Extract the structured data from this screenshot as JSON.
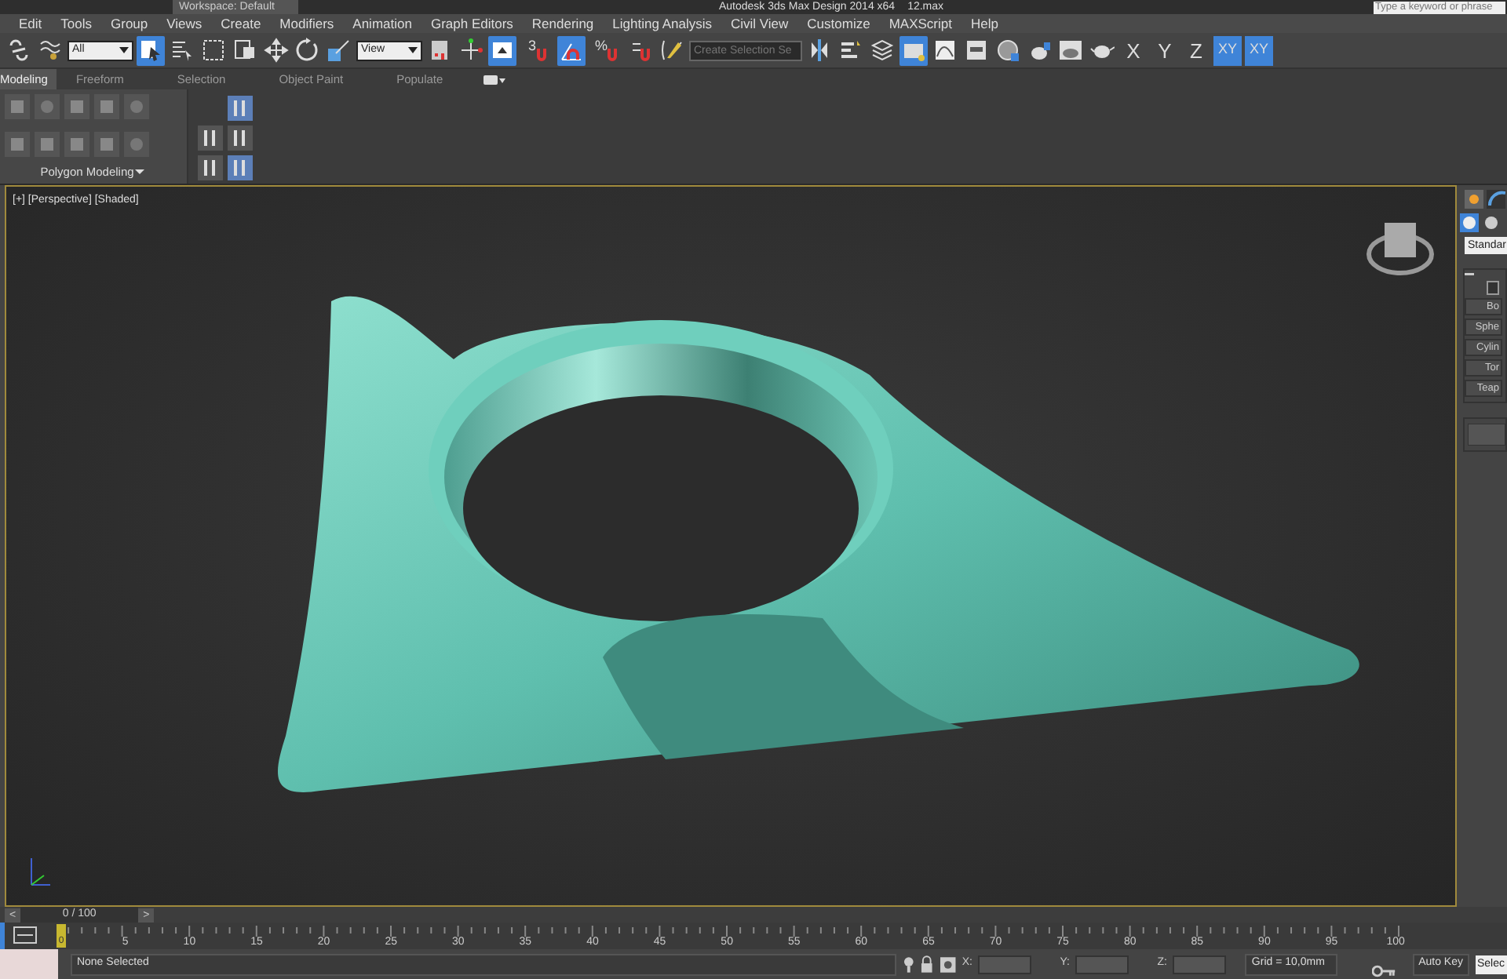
{
  "title_bar": {
    "workspace": "Workspace: Default",
    "title": "Autodesk 3ds Max Design 2014 x64",
    "file": "12.max",
    "search": {
      "placeholder": "Type a keyword or phrase"
    }
  },
  "menu": [
    "Edit",
    "Tools",
    "Group",
    "Views",
    "Create",
    "Modifiers",
    "Animation",
    "Graph Editors",
    "Rendering",
    "Lighting Analysis",
    "Civil View",
    "Customize",
    "MAXScript",
    "Help"
  ],
  "toolbar": [
    {
      "kind": "icon",
      "selected": false
    },
    {
      "kind": "icon",
      "selected": false
    },
    {
      "kind": "dropdown",
      "value": "All"
    },
    {
      "kind": "icon",
      "selected": true
    },
    {
      "kind": "icon",
      "selected": false
    },
    {
      "kind": "icon",
      "selected": false
    },
    {
      "kind": "icon",
      "selected": false
    },
    {
      "kind": "icon",
      "selected": false
    },
    {
      "kind": "icon",
      "selected": false
    },
    {
      "kind": "icon",
      "selected": false
    },
    {
      "kind": "dropdown",
      "value": "View"
    },
    {
      "kind": "icon",
      "selected": false
    },
    {
      "kind": "icon",
      "selected": false
    },
    {
      "kind": "icon",
      "selected": true
    },
    {
      "kind": "snap",
      "text": "3",
      "selected": false
    },
    {
      "kind": "icon",
      "selected": true
    },
    {
      "kind": "snap",
      "text": "%",
      "selected": false
    },
    {
      "kind": "icon",
      "selected": false
    },
    {
      "kind": "icon",
      "selected": false
    },
    {
      "kind": "field",
      "placeholder": "Create Selection Se"
    },
    {
      "kind": "icon",
      "selected": false
    },
    {
      "kind": "icon",
      "selected": false
    },
    {
      "kind": "icon",
      "selected": false
    },
    {
      "kind": "icon",
      "selected": true
    },
    {
      "kind": "icon",
      "selected": false
    },
    {
      "kind": "icon",
      "selected": false
    },
    {
      "kind": "icon",
      "selected": false
    },
    {
      "kind": "icon",
      "selected": false
    },
    {
      "kind": "icon",
      "selected": false
    },
    {
      "kind": "icon",
      "selected": false
    },
    {
      "kind": "axis",
      "text": "X",
      "selected": false
    },
    {
      "kind": "axis",
      "text": "Y",
      "selected": false
    },
    {
      "kind": "axis",
      "text": "Z",
      "selected": false
    },
    {
      "kind": "axis",
      "text": "XY",
      "selected": true
    },
    {
      "kind": "axis",
      "text": "XY",
      "selected": true
    }
  ],
  "ribbon_tabs": [
    {
      "label": "Modeling",
      "selected": true
    },
    {
      "label": "Freeform",
      "selected": false
    },
    {
      "label": "Selection",
      "selected": false
    },
    {
      "label": "Object Paint",
      "selected": false
    },
    {
      "label": "Populate",
      "selected": false
    }
  ],
  "ribbon_panel": {
    "title": "Polygon Modeling"
  },
  "viewport": {
    "label": "[+] [Perspective] [Shaded]"
  },
  "command_panel": {
    "dropdown": "Standar",
    "checked": false,
    "buttons": [
      "Bo",
      "Sphe",
      "Cylin",
      "Tor",
      "Teap"
    ]
  },
  "time_slider": {
    "prev": "<",
    "frame": "0 / 100",
    "next": ">",
    "current": "0",
    "ticks": [
      "5",
      "10",
      "15",
      "20",
      "25",
      "30",
      "35",
      "40",
      "45",
      "50",
      "55",
      "60",
      "65",
      "70",
      "75",
      "80",
      "85",
      "90",
      "95",
      "100"
    ]
  },
  "status_bar": {
    "selection": "None Selected",
    "x_label": "X:",
    "y_label": "Y:",
    "z_label": "Z:",
    "grid": "Grid = 10,0mm",
    "auto_key": "Auto Key",
    "key_field": "Selec"
  }
}
